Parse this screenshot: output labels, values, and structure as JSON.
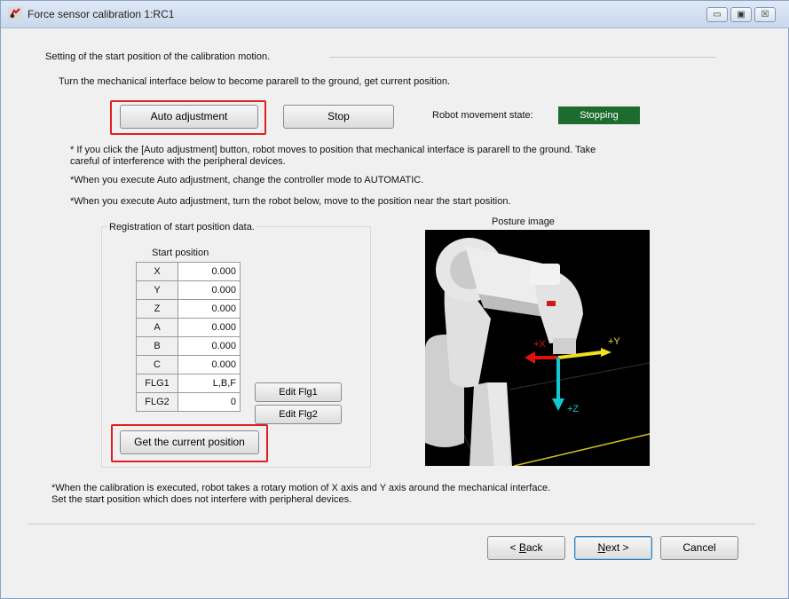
{
  "window": {
    "title": "Force sensor calibration 1:RC1",
    "controls": [
      "▭",
      "▣",
      "☒"
    ]
  },
  "section_title": "Setting of the start position of the calibration motion.",
  "instruction": "Turn the mechanical interface below to become pararell to the ground, get current position.",
  "buttons": {
    "auto_adjustment": "Auto adjustment",
    "stop": "Stop",
    "get_current_position": "Get the current position",
    "edit_flg1": "Edit Flg1",
    "edit_flg2": "Edit Flg2",
    "back_prefix": "< ",
    "back_key": "B",
    "back_rest": "ack",
    "next_key": "N",
    "next_rest": "ext >",
    "cancel": "Cancel"
  },
  "robot_state": {
    "label": "Robot movement state:",
    "value": "Stopping",
    "color": "#1e6b2e"
  },
  "notes": {
    "note1_line1": "* If you click the [Auto adjustment] button, robot moves to position that mechanical interface is pararell to the ground. Take",
    "note1_line2": "careful of  interference with the peripheral devices.",
    "note2": "*When you execute Auto adjustment, change the controller mode to AUTOMATIC.",
    "note3": "*When you execute Auto adjustment, turn the robot below, move to the position near the start position."
  },
  "registration": {
    "title": "Registration of start position data.",
    "start_position_label": "Start position",
    "rows": [
      {
        "label": "X",
        "value": "0.000"
      },
      {
        "label": "Y",
        "value": "0.000"
      },
      {
        "label": "Z",
        "value": "0.000"
      },
      {
        "label": "A",
        "value": "0.000"
      },
      {
        "label": "B",
        "value": "0.000"
      },
      {
        "label": "C",
        "value": "0.000"
      },
      {
        "label": "FLG1",
        "value": "L,B,F"
      },
      {
        "label": "FLG2",
        "value": "0"
      }
    ]
  },
  "posture": {
    "title": "Posture image",
    "axis_labels": {
      "x": "+X",
      "y": "+Y",
      "z": "+Z"
    }
  },
  "footer_note": {
    "line1": "*When the calibration is executed, robot takes a rotary motion of X axis and Y axis around the mechanical interface.",
    "line2": "Set the start position which does not interfere with peripheral devices."
  },
  "colors": {
    "highlight": "#e02020",
    "axis_x": "#e01010",
    "axis_y": "#f0e020",
    "axis_z": "#10c8d0"
  }
}
